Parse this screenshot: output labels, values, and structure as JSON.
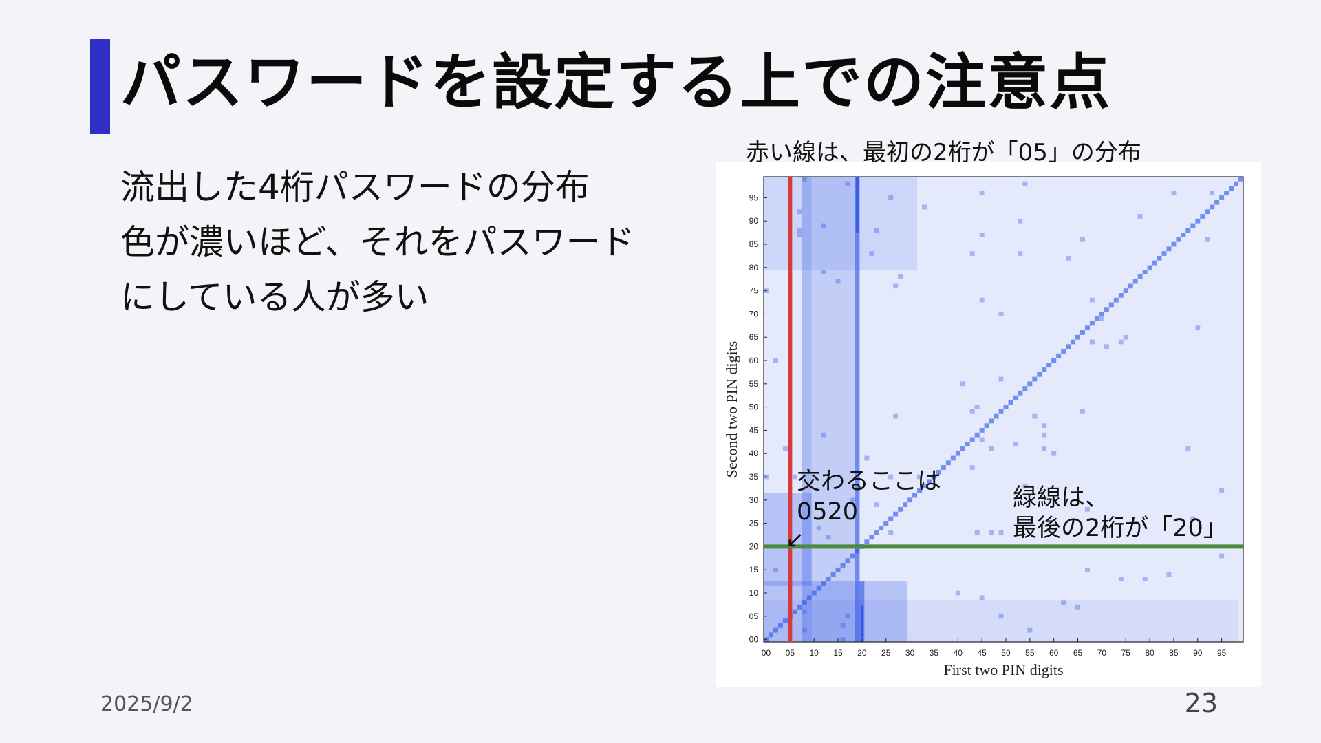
{
  "slide": {
    "title": "パスワードを設定する上での注意点",
    "body_lines": [
      "流出した4桁パスワードの分布",
      "色が濃いほど、それをパスワード",
      "にしている人が多い"
    ],
    "figure_caption": "赤い線は、最初の2桁が「05」の分布",
    "annotation_intersection": {
      "line1": "交わるここは",
      "line2": "0520",
      "arrow": "↙"
    },
    "annotation_green": {
      "line1": "緑線は、",
      "line2": "最後の2桁が「20」"
    },
    "footer_date": "2025/9/2",
    "page_number": "23",
    "accent_color": "#3030c8"
  },
  "chart_data": {
    "type": "heatmap",
    "xlabel": "First two PIN digits",
    "ylabel": "Second two PIN digits",
    "x_ticks": [
      "00",
      "05",
      "10",
      "15",
      "20",
      "25",
      "30",
      "35",
      "40",
      "45",
      "50",
      "55",
      "60",
      "65",
      "70",
      "75",
      "80",
      "85",
      "90",
      "95"
    ],
    "y_ticks": [
      "00",
      "05",
      "10",
      "15",
      "20",
      "25",
      "30",
      "35",
      "40",
      "45",
      "50",
      "55",
      "60",
      "65",
      "70",
      "75",
      "80",
      "85",
      "90",
      "95"
    ],
    "xlim": [
      0,
      99
    ],
    "ylim": [
      0,
      99
    ],
    "highlight_lines": [
      {
        "axis": "x",
        "value": 5,
        "color": "#d63a3a"
      },
      {
        "axis": "y",
        "value": 20,
        "color": "#4b8a3c"
      }
    ],
    "colors": {
      "low": "#e4e9fb",
      "high": "#2b52e6"
    }
  }
}
